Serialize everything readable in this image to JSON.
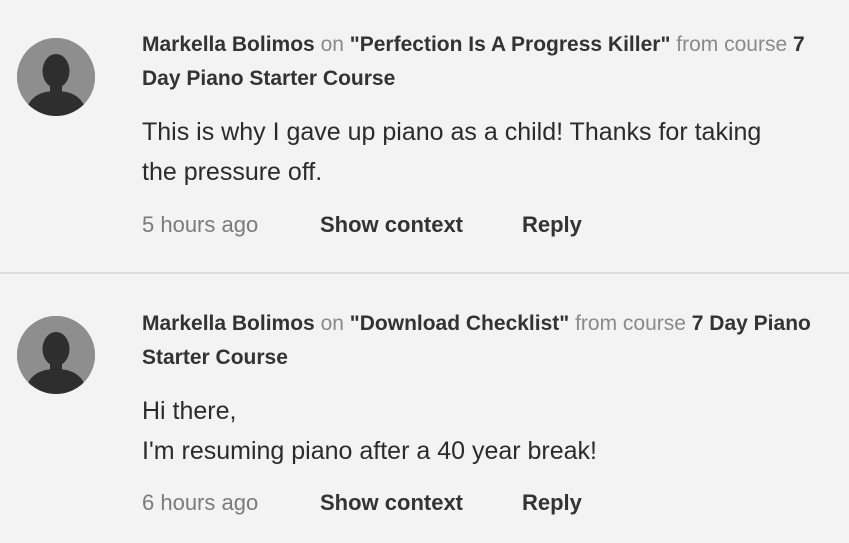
{
  "comments": [
    {
      "author": "Markella Bolimos",
      "on_word": "on",
      "lesson": "\"Perfection Is A Progress Killer\"",
      "from_word": "from course",
      "course": "7 Day Piano Starter Course",
      "body_lines": [
        "This is why I gave up piano as a child! Thanks for taking the pressure off."
      ],
      "time": "5 hours ago",
      "show_context_label": "Show context",
      "reply_label": "Reply"
    },
    {
      "author": "Markella Bolimos",
      "on_word": "on",
      "lesson": "\"Download Checklist\"",
      "from_word": "from course",
      "course": "7 Day Piano Starter Course",
      "body_lines": [
        "Hi there,",
        "I'm resuming piano after a 40 year break!"
      ],
      "time": "6 hours ago",
      "show_context_label": "Show context",
      "reply_label": "Reply"
    }
  ],
  "icons": {
    "avatar": "default-user-avatar-icon"
  },
  "colors": {
    "background": "#f3f3f3",
    "avatar_bg": "#8e8e8e",
    "avatar_silhouette": "#2e2e2e",
    "muted_text": "#8a8a8a",
    "strong_text": "#333333"
  }
}
